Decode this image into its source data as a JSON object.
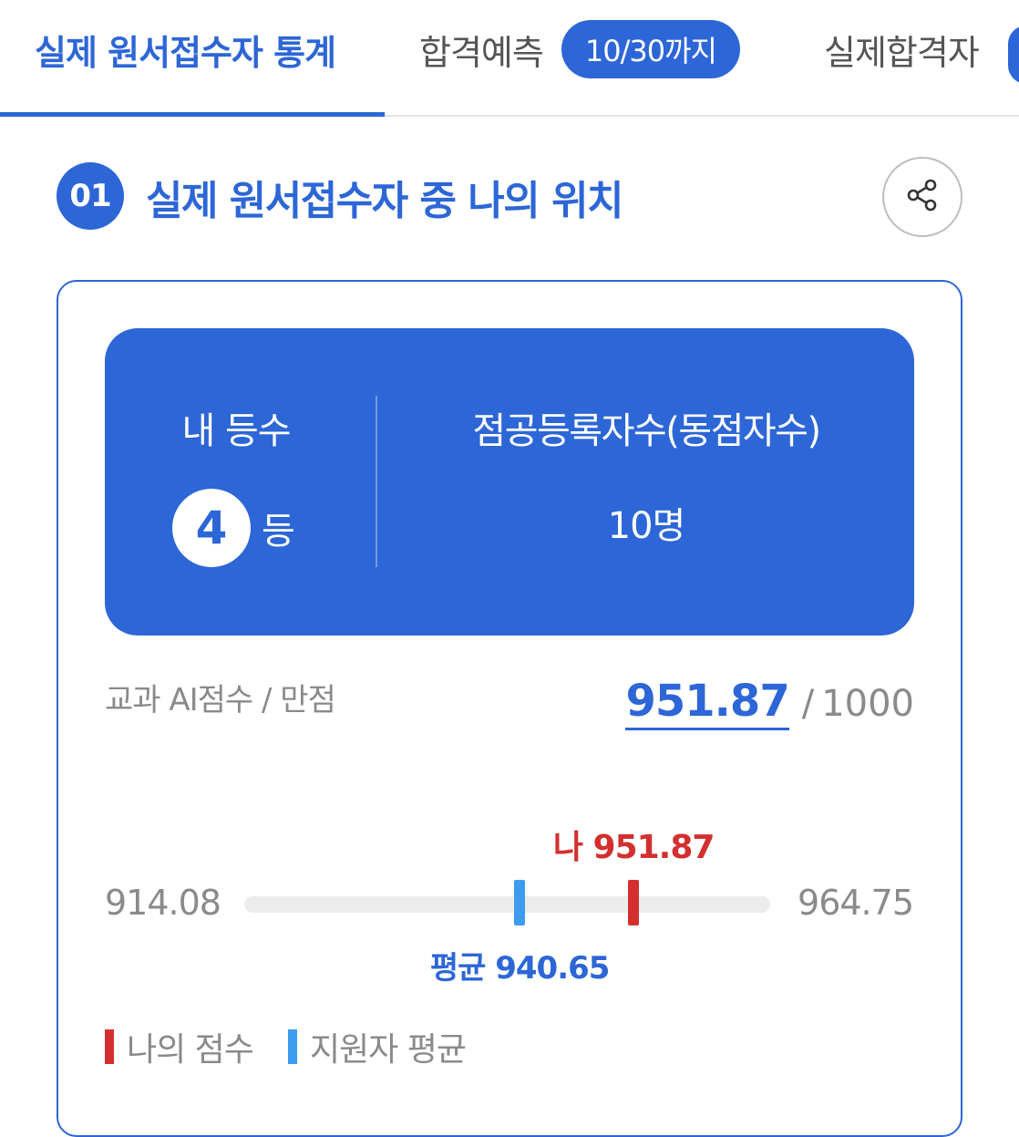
{
  "tabs": [
    {
      "label": "실제 원서접수자 통계",
      "active": true
    },
    {
      "label": "합격예측",
      "badge": "10/30까지"
    },
    {
      "label": "실제합격자"
    }
  ],
  "section": {
    "number": "01",
    "title": "실제 원서접수자 중 나의 위치"
  },
  "rank_box": {
    "rank_label": "내 등수",
    "rank_value": "4",
    "rank_unit": "등",
    "tie_label": "점공등록자수(동점자수)",
    "tie_value": "10명"
  },
  "score": {
    "label": "교과 AI점수 / 만점",
    "mine": "951.87",
    "separator": "/",
    "max": "1000"
  },
  "range": {
    "min": 914.08,
    "max": 964.75,
    "min_label": "914.08",
    "max_label": "964.75",
    "my_score": 951.87,
    "average": 940.65,
    "my_label": "나 951.87",
    "avg_label": "평균 940.65"
  },
  "legend": [
    {
      "label": "나의 점수",
      "color": "#d32f2f"
    },
    {
      "label": "지원자 평균",
      "color": "#3d9bf0"
    }
  ],
  "colors": {
    "accent": "#2d66d6",
    "my_score": "#d32f2f",
    "average": "#3d9bf0"
  }
}
